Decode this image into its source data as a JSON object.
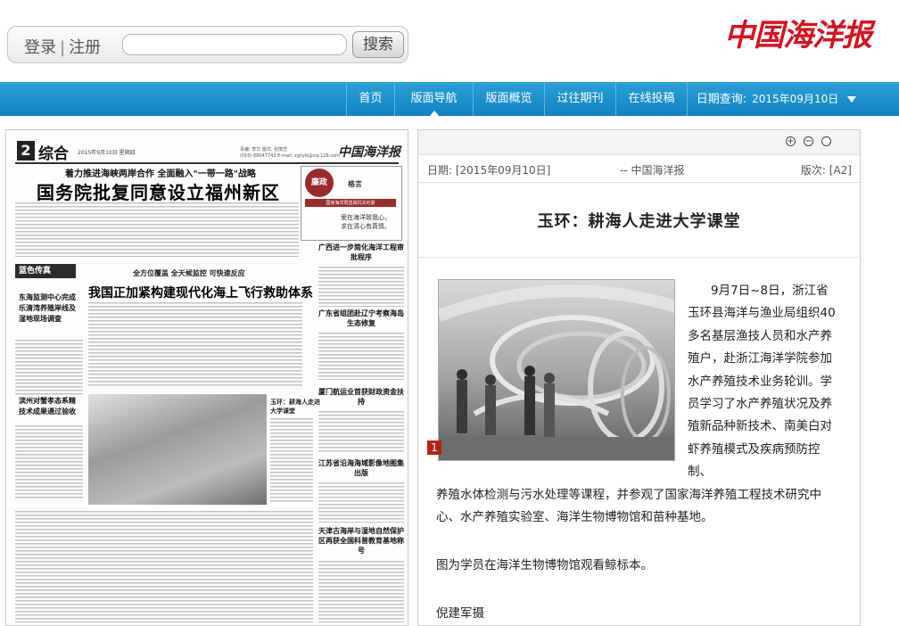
{
  "header": {
    "login_label": "登录",
    "register_label": "注册",
    "search_placeholder": "",
    "search_button": "搜索",
    "logo_text": "中国海洋报"
  },
  "nav": {
    "items": [
      "首页",
      "版面导航",
      "版面概览",
      "过往期刊",
      "在线投稿"
    ],
    "active_index": 1,
    "date_label": "日期查询:",
    "date_value": "2015年09月10日"
  },
  "newspaper": {
    "page_number": "2",
    "section": "综合",
    "date_line": "2015年9月10日 星期四",
    "editors": "责编: 李华  版式: 张丽芝",
    "tel": "(010) 68047743  E-mail: zghyb@vip.126.com",
    "logo": "中国海洋报",
    "kicker": "着力推进海峡两岸合作 全面融入\"一带一路\"战略",
    "headline": "国务院批复同意设立福州新区",
    "editorial_badge": "廉政",
    "editorial_title": "格言",
    "editorial_sub": "国家海洋局直属机关纪委",
    "editorial_quote": "爱在海洋致我心，求在清心有真情。",
    "banner": "蓝色传真",
    "mid_kicker": "全方位覆盖  全天候监控  可快速反应",
    "mid_headline": "我国正加紧构建现代化海上飞行救助体系",
    "left_sub1": "东海监测中心完成乐清湾养殖岸线及湿地现场调查",
    "left_sub2": "滨州对蟹孝态系精技术成果通过验收",
    "right_sub1": "广西进一步简化海洋工程审批程序",
    "right_sub2": "广东省组团赴辽宁考察海岛生态修复",
    "right_sub3": "厦门航运业首获财政资金扶持",
    "right_sub4": "江苏省沿海海域影像地图集出版",
    "right_sub5": "天津古海岸与湿地自然保护区再获全国科普教育基地称号",
    "small_photo_caption": "玉环：耕海人走进大学课堂"
  },
  "article": {
    "date": "日期: [2015年09月10日]",
    "source": "-- 中国海洋报",
    "version": "版次: [A2]",
    "title": "玉环：耕海人走进大学课堂",
    "photo_marker": "1",
    "paragraph_1": "9月7日~8日，浙江省玉环县海洋与渔业局组织40多名基层渔技人员和水产养殖户，赴浙江海洋学院参加水产养殖技术业务轮训。学员学习了水产养殖状况及养殖新品种新技术、南美白对虾养殖模式及疾病预防控制、养殖水体检测与污水处理等课程，并参观了国家海洋养殖工程技术研究中心、水产养殖实验室、海洋生物博物馆和苗种基地。",
    "caption": "图为学员在海洋生物博物馆观看鲸标本。",
    "author": "倪建军摄"
  },
  "colors": {
    "nav_blue": "#1a8fcc",
    "logo_red": "#d8121f"
  },
  "icons": [
    "zoom-in-icon",
    "zoom-out-icon",
    "zoom-reset-icon"
  ]
}
